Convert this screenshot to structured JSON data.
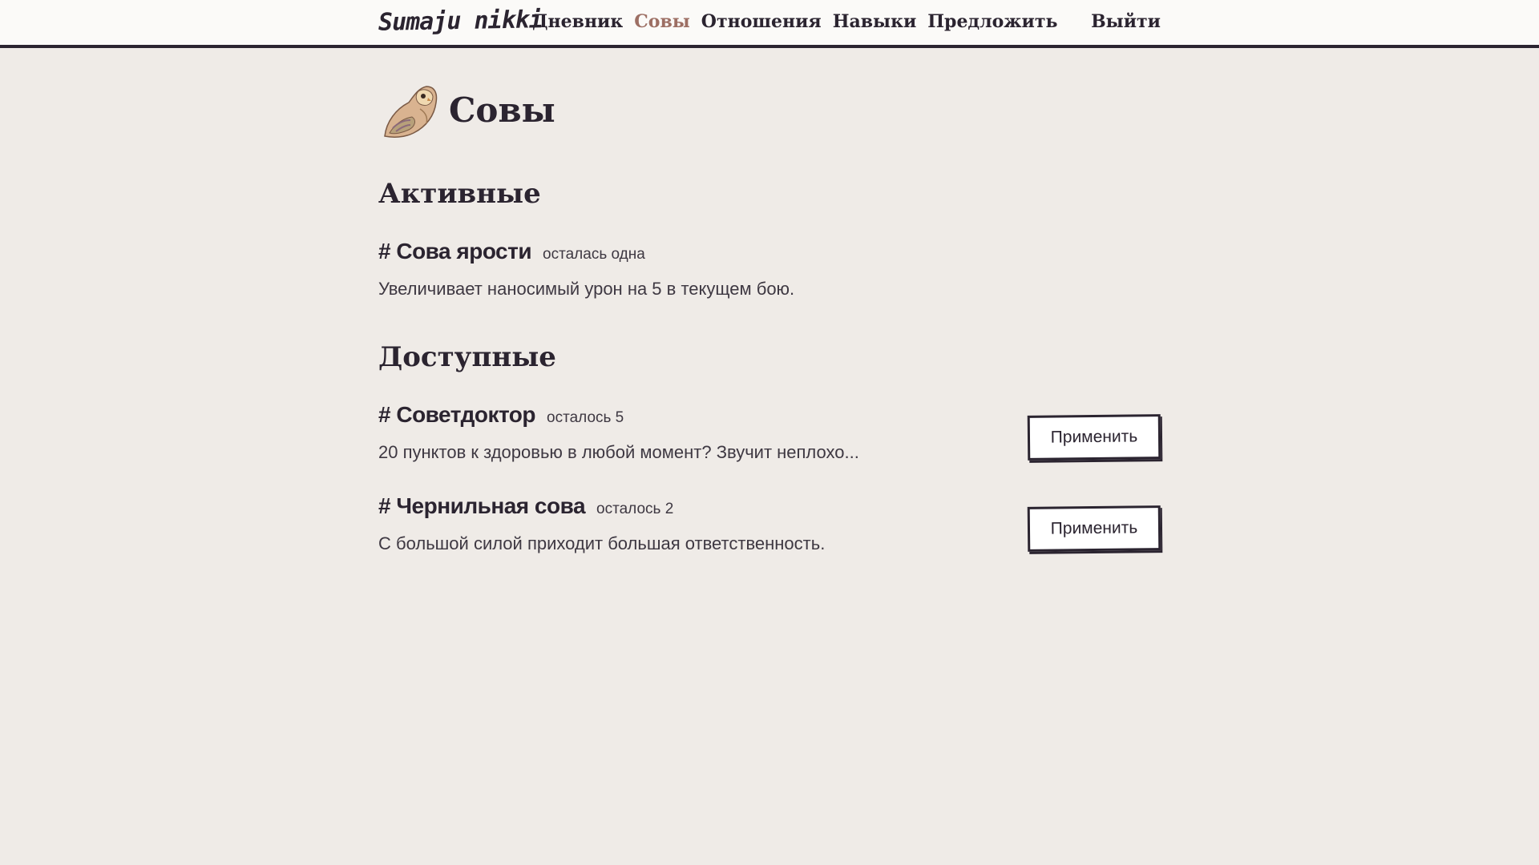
{
  "header": {
    "brand": "Sumaju nikki",
    "nav": [
      "Дневник",
      "Совы",
      "Отношения",
      "Навыки",
      "Предложить"
    ],
    "active_nav": "Совы",
    "logout": "Выйти"
  },
  "page": {
    "title": "Совы",
    "icon": "owl-icon"
  },
  "active_section": {
    "title": "Активные",
    "items": [
      {
        "name": "# Сова ярости",
        "count": "осталась одна",
        "description": "Увеличивает наносимый урон на 5 в текущем бою."
      }
    ]
  },
  "available_section": {
    "title": "Доступные",
    "items": [
      {
        "name": "# Советдоктор",
        "count": "осталось 5",
        "description": "20 пунктов к здоровью в любой момент? Звучит неплохо...",
        "button": "Применить"
      },
      {
        "name": "# Чернильная сова",
        "count": "осталось 2",
        "description": "С большой силой приходит большая ответственность.",
        "button": "Применить"
      }
    ]
  },
  "colors": {
    "background": "#efebe7",
    "header_bg": "#fbfaf8",
    "text": "#2b2430",
    "accent": "#9d6f64"
  }
}
